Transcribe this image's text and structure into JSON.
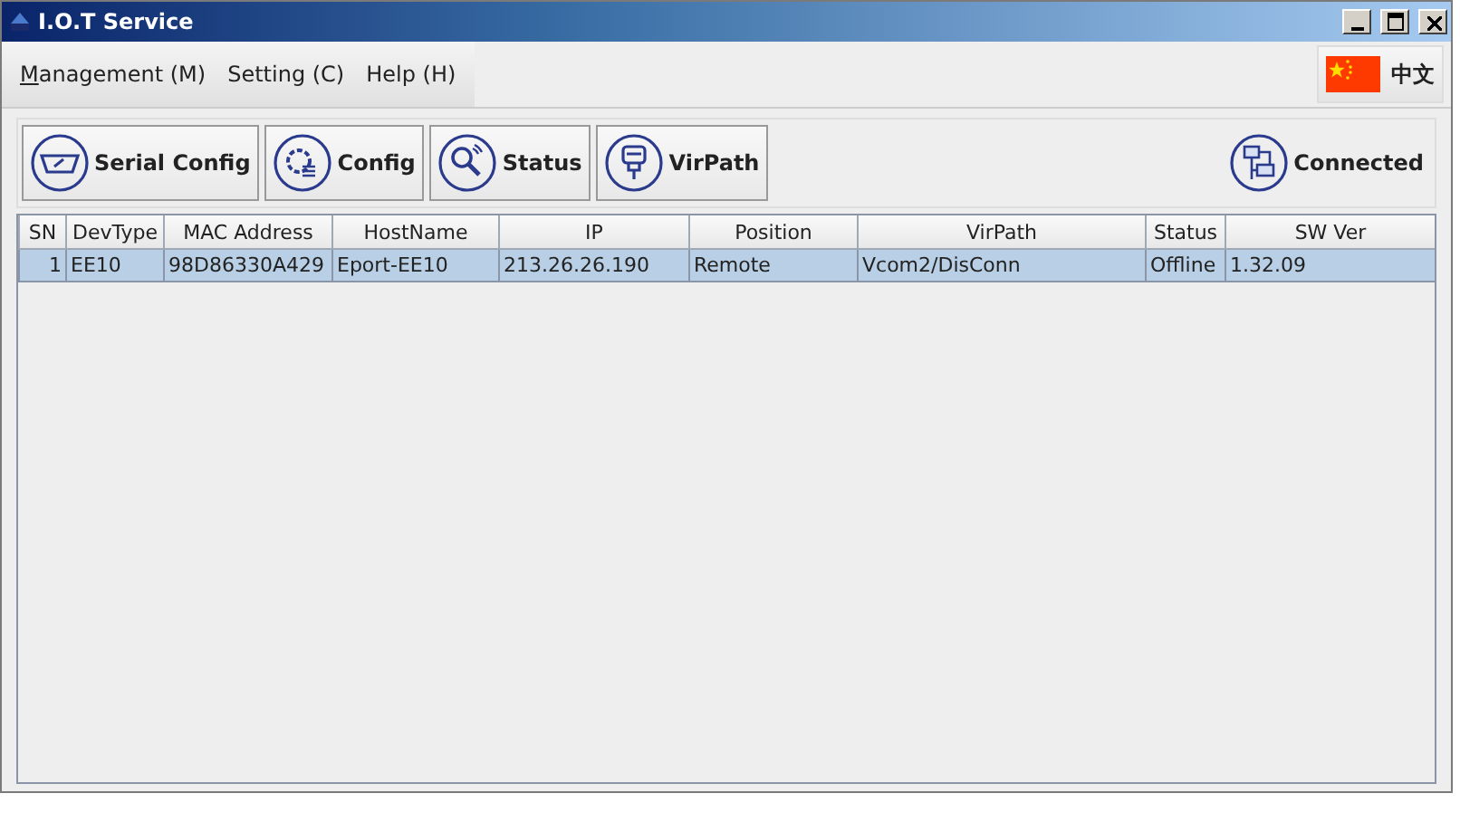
{
  "window": {
    "title": "I.O.T Service"
  },
  "menu": [
    {
      "label": "Management (M)"
    },
    {
      "label": "Setting (C)"
    },
    {
      "label": "Help (H)"
    }
  ],
  "language_button": {
    "label": "中文"
  },
  "toolbar": [
    {
      "kind": "serial",
      "label": "Serial Config"
    },
    {
      "kind": "config",
      "label": "Config"
    },
    {
      "kind": "status",
      "label": "Status"
    },
    {
      "kind": "virpath",
      "label": "VirPath"
    }
  ],
  "connection": {
    "label": "Connected"
  },
  "table": {
    "columns": [
      "SN",
      "DevType",
      "MAC Address",
      "HostName",
      "IP",
      "Position",
      "VirPath",
      "Status",
      "SW Ver"
    ],
    "rows": [
      {
        "selected": true,
        "cells": [
          "1",
          "EE10",
          "98D86330A429",
          "Eport-EE10",
          "213.26.26.190",
          "Remote",
          "Vcom2/DisConn",
          "Offline",
          "1.32.09"
        ]
      }
    ]
  }
}
